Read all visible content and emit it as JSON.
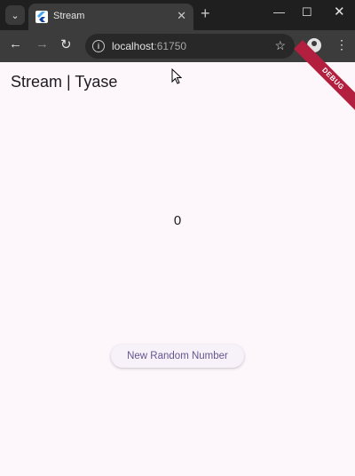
{
  "browser": {
    "tab": {
      "title": "Stream",
      "close_glyph": "✕"
    },
    "new_tab_glyph": "+",
    "window": {
      "minimize_glyph": "—",
      "maximize_glyph": "☐",
      "close_glyph": "✕"
    },
    "nav": {
      "back_glyph": "←",
      "forward_glyph": "→",
      "reload_glyph": "↻"
    },
    "address": {
      "host": "localhost",
      "port": ":61750"
    },
    "icons": [
      "tab-menu-icon",
      "flutter-favicon-icon",
      "info-icon",
      "star-icon",
      "profile-icon",
      "kebab-menu-icon"
    ]
  },
  "app": {
    "title": "Stream | Tyase",
    "counter_value": "0",
    "button_label": "New Random Number",
    "debug_banner": "DEBUG"
  },
  "colors": {
    "background": "#fdf7fc",
    "button_text": "#65558f",
    "debug_banner": "#b3203f",
    "browser_chrome": "#3c3c3c"
  }
}
